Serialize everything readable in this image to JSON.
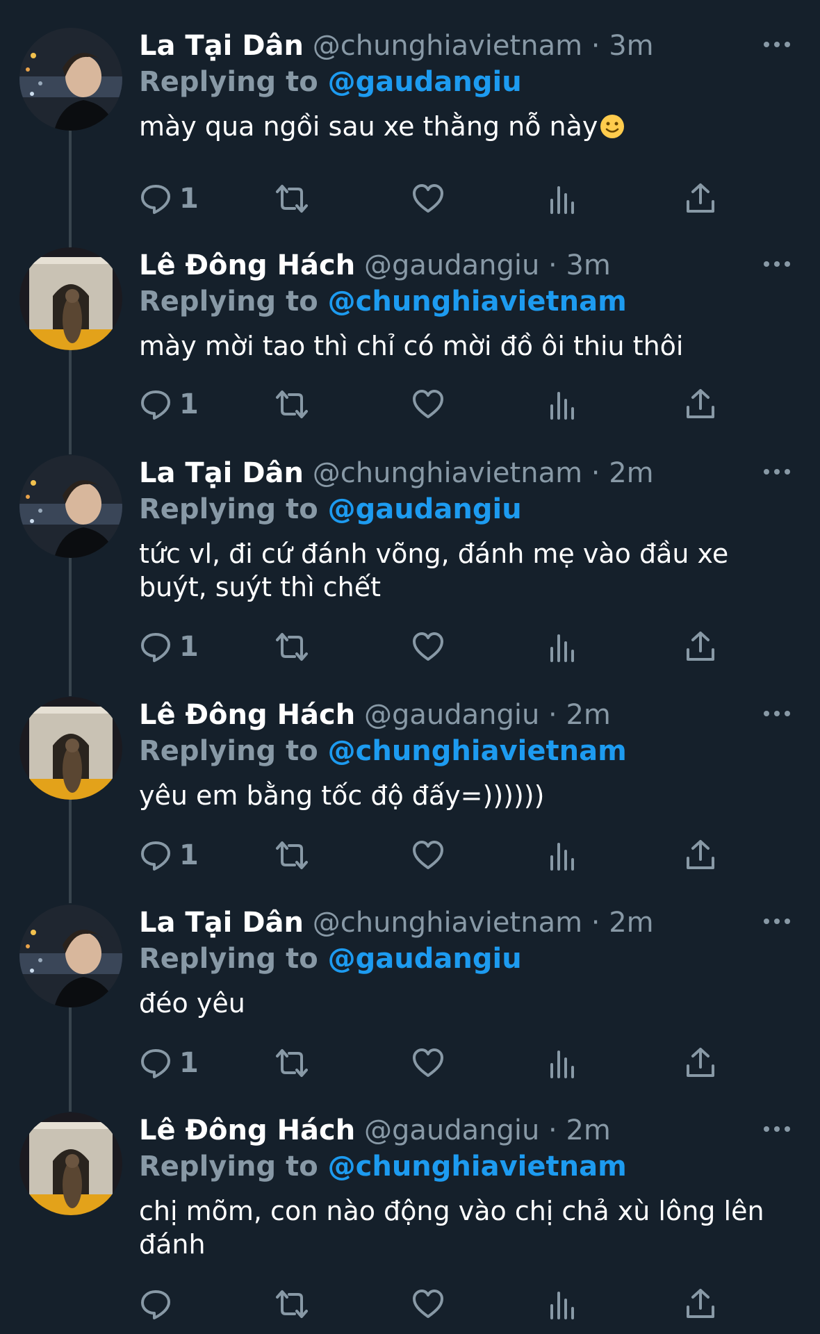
{
  "users": {
    "a": {
      "name": "La Tại Dân",
      "handle": "@chunghiavietnam"
    },
    "b": {
      "name": "Lê Đông Hách",
      "handle": "@gaudangiu"
    }
  },
  "reply_prefix": "Replying to",
  "dot": "·",
  "tweets": [
    {
      "name": "La Tại Dân",
      "handle": "@chunghiavietnam",
      "time": "3m",
      "reply_to": "@gaudangiu",
      "text": "mày qua ngồi sau xe thằng nỗ này",
      "emoji": "slightly-smiling-face",
      "reply_count": "1"
    },
    {
      "name": "Lê Đông Hách",
      "handle": "@gaudangiu",
      "time": "3m",
      "reply_to": "@chunghiavietnam",
      "text": "mày mời tao thì chỉ có mời đồ ôi thiu thôi",
      "reply_count": "1"
    },
    {
      "name": "La Tại Dân",
      "handle": "@chunghiavietnam",
      "time": "2m",
      "reply_to": "@gaudangiu",
      "text": "tức vl, đi cứ đánh võng, đánh mẹ vào đầu xe buýt, suýt thì chết",
      "reply_count": "1"
    },
    {
      "name": "Lê Đông Hách",
      "handle": "@gaudangiu",
      "time": "2m",
      "reply_to": "@chunghiavietnam",
      "text": "yêu em bằng tốc độ đấy=))))))",
      "reply_count": "1"
    },
    {
      "name": "La Tại Dân",
      "handle": "@chunghiavietnam",
      "time": "2m",
      "reply_to": "@gaudangiu",
      "text": "đéo yêu",
      "reply_count": "1"
    },
    {
      "name": "Lê Đông Hách",
      "handle": "@gaudangiu",
      "time": "2m",
      "reply_to": "@chunghiavietnam",
      "text": "chị mõm, con nào động vào chị chả xù lông lên đánh",
      "reply_count": ""
    }
  ],
  "icons": [
    "more-icon",
    "reply-icon",
    "retweet-icon",
    "like-icon",
    "analytics-icon",
    "share-icon"
  ],
  "colors": {
    "background": "#15202b",
    "muted": "#8899a6",
    "link": "#1d9bf0",
    "thread_line": "#38444d"
  }
}
